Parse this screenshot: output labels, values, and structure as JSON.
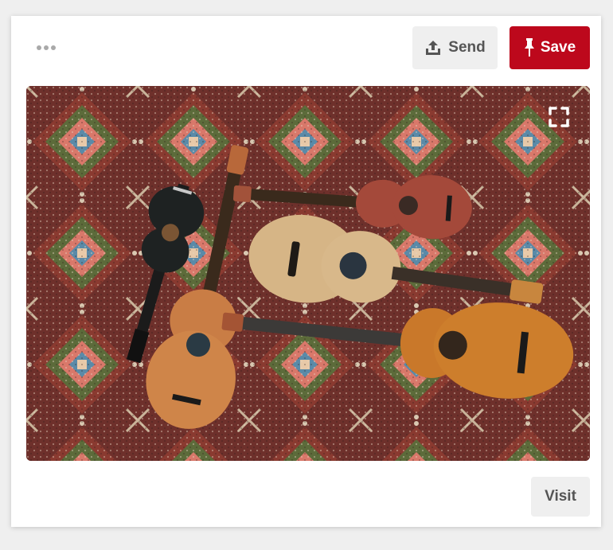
{
  "header": {
    "more_icon": "more-dots-icon",
    "send": {
      "label": "Send",
      "icon": "share-upload-icon"
    },
    "save": {
      "label": "Save",
      "icon": "pushpin-icon",
      "color": "#bd081c"
    }
  },
  "pin": {
    "expand_icon": "expand-fullscreen-icon"
  },
  "footer": {
    "visit_label": "Visit"
  }
}
